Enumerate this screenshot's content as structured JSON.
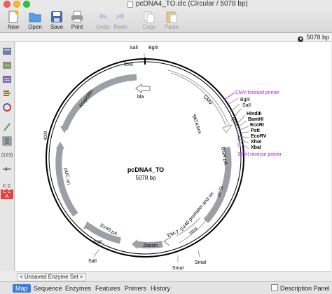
{
  "window": {
    "title": "pcDNA4_TO.clc  (Circular / 5078 bp)"
  },
  "toolbar": {
    "new": "New",
    "open": "Open",
    "save": "Save",
    "print": "Print",
    "undo": "Undo",
    "redo": "Redo",
    "copy": "Copy",
    "paste": "Paste"
  },
  "infobar": {
    "length": "5078 bp"
  },
  "sidebar": {
    "count": "(123)",
    "seq_top": "C C A",
    "seq_bottom": "C C A"
  },
  "map": {
    "name": "pcDNA4_TO",
    "length": "5078 bp",
    "ticks": [
      "5000",
      "1000",
      "2000",
      "3000",
      "4000"
    ],
    "top_sites": [
      "SalI",
      "BglII"
    ],
    "right_sites": [
      "BglII",
      "SalI",
      "HindIII",
      "BamHI",
      "EcoRI",
      "PstI",
      "EcoRV",
      "XhoI",
      "XbaI"
    ],
    "bottom_sites": [
      "SmaI",
      "SmaI",
      "SalI"
    ],
    "primers": {
      "cmv_forward": "CMV forward primer",
      "bgh_reverse": "BGH reverse primer"
    },
    "features": {
      "cmv": "CMV",
      "tata": "TATA box",
      "bgh": "BGH pA",
      "f1": "f1 ori",
      "sv40": "SV40 promoter and ori",
      "em7": "EM-7",
      "zeocin": "Zeocin",
      "sv40pa": "SV40 pA",
      "puc": "pUC ori",
      "ampicillin": "Ampicillin",
      "bla": "bla"
    }
  },
  "unsaved": {
    "label": "< Unsaved Enzyme Set >"
  },
  "tabs": [
    "Map",
    "Sequence",
    "Enzymes",
    "Features",
    "Primers",
    "History"
  ],
  "description_panel": "Description Panel",
  "colors": {
    "feature_fill": "#9aa0a6",
    "primer": "#a020f0",
    "tab_selected": "#3a7bdc"
  }
}
